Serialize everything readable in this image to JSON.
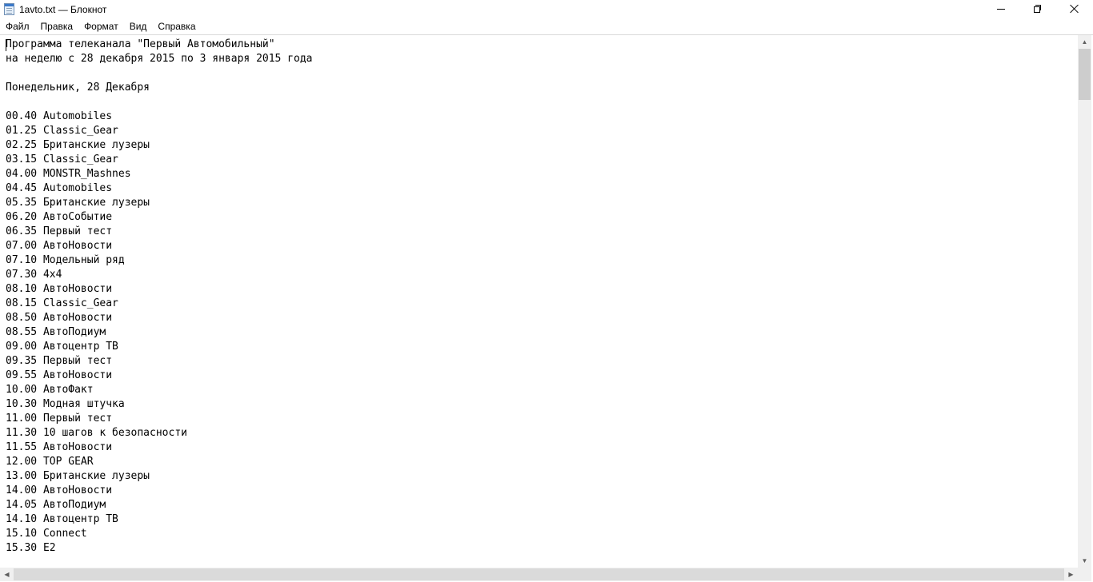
{
  "window": {
    "title": "1avto.txt — Блокнот",
    "icon": "notepad-icon",
    "controls": {
      "minimize_icon": "minimize-icon",
      "maximize_icon": "restore-icon",
      "close_icon": "close-icon"
    }
  },
  "menu": [
    {
      "label": "Файл"
    },
    {
      "label": "Правка"
    },
    {
      "label": "Формат"
    },
    {
      "label": "Вид"
    },
    {
      "label": "Справка"
    }
  ],
  "document": {
    "lines": [
      "Программа телеканала \"Первый Автомобильный\"",
      "на неделю с 28 декабря 2015 по 3 января 2015 года",
      "",
      "Понедельник, 28 Декабря",
      "",
      "00.40 Automobiles",
      "01.25 Classic_Gear",
      "02.25 Британские лузеры",
      "03.15 Classic_Gear",
      "04.00 MONSTR_Mashnes",
      "04.45 Automobiles",
      "05.35 Британские лузеры",
      "06.20 АвтоСобытие",
      "06.35 Первый тест",
      "07.00 АвтоНовости",
      "07.10 Модельный ряд",
      "07.30 4х4",
      "08.10 АвтоНовости",
      "08.15 Classic_Gear",
      "08.50 АвтоНовости",
      "08.55 АвтоПодиум",
      "09.00 Автоцентр ТВ",
      "09.35 Первый тест",
      "09.55 АвтоНовости",
      "10.00 АвтоФакт",
      "10.30 Модная штучка",
      "11.00 Первый тест",
      "11.30 10 шагов к безопасности",
      "11.55 АвтоНовости",
      "12.00 TOP GEAR",
      "13.00 Британские лузеры",
      "14.00 АвтоНовости",
      "14.05 АвтоПодиум",
      "14.10 Автоцентр ТВ",
      "15.10 Connect",
      "15.30 E2"
    ]
  },
  "scrollbars": {
    "vertical": {
      "up_icon": "scroll-up-arrow-icon",
      "down_icon": "scroll-down-arrow-icon"
    },
    "horizontal": {
      "left_icon": "scroll-left-arrow-icon",
      "right_icon": "scroll-right-arrow-icon"
    }
  }
}
